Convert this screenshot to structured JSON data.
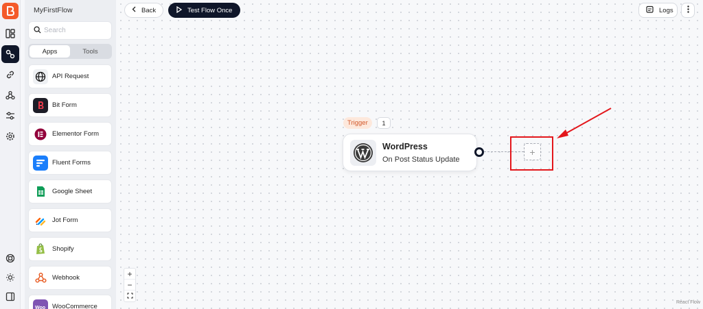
{
  "rail": {
    "icons": [
      "logo-icon",
      "dashboard-icon",
      "flows-icon",
      "link-icon",
      "webhook-icon",
      "sliders-icon",
      "gear-icon",
      "support-icon",
      "theme-icon",
      "collapse-icon"
    ]
  },
  "panel": {
    "flow_name": "MyFirstFlow",
    "search_placeholder": "Search",
    "tabs": [
      {
        "label": "Apps",
        "active": true
      },
      {
        "label": "Tools",
        "active": false
      }
    ],
    "apps": [
      {
        "label": "API Request",
        "icon": "globe-icon"
      },
      {
        "label": "Bit Form",
        "icon": "bit-form-icon"
      },
      {
        "label": "Elementor Form",
        "icon": "elementor-icon"
      },
      {
        "label": "Fluent Forms",
        "icon": "fluent-forms-icon"
      },
      {
        "label": "Google Sheet",
        "icon": "google-sheet-icon"
      },
      {
        "label": "Jot Form",
        "icon": "jotform-icon"
      },
      {
        "label": "Shopify",
        "icon": "shopify-icon"
      },
      {
        "label": "Webhook",
        "icon": "webhook-icon"
      },
      {
        "label": "WooCommerce",
        "icon": "woocommerce-icon"
      }
    ]
  },
  "toolbar": {
    "back_label": "Back",
    "test_label": "Test Flow Once",
    "logs_label": "Logs"
  },
  "node": {
    "badge": "Trigger",
    "count": "1",
    "title": "WordPress",
    "subtitle": "On Post Status Update",
    "add_symbol": "+"
  },
  "zoom": {
    "in": "+",
    "out": "−"
  },
  "attribution": "React Flow",
  "colors": {
    "brand": "#f45a2a",
    "dark": "#0f1629",
    "highlight": "#e3161b"
  }
}
